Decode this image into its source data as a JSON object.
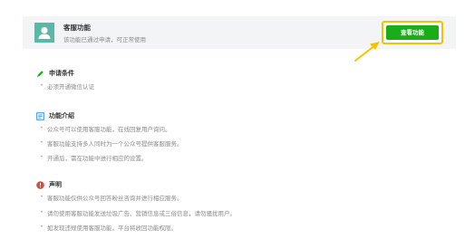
{
  "feature": {
    "name": "客服功能",
    "status": "该功能已通过申请，可正常使用",
    "view_button_label": "查看功能"
  },
  "colors": {
    "accent_green": "#1aad19",
    "highlight_yellow": "#f0c400",
    "avatar_teal": "#5cb7a5",
    "notice_red": "#e64340",
    "intro_blue": "#3a8ee6"
  },
  "sections": {
    "requirements": {
      "title": "申请条件",
      "icon": "pencil-icon",
      "items": [
        "必须开通微信认证"
      ]
    },
    "intro": {
      "title": "功能介绍",
      "icon": "document-icon",
      "items": [
        "公众号可以使用客服功能，在线回复用户询问。",
        "客服功能支持多人同时为一个公众号提供客服服务。",
        "开通后，需在功能中进行相应的设置。"
      ]
    },
    "statement": {
      "title": "声明",
      "icon": "warning-icon",
      "items": [
        "客服功能仅供公众号回答粉丝咨询并进行相应服务。",
        "请勿使用客服功能发送垃圾广告、营销信息或三俗信息，请勿骚扰用户。",
        "如发现违规使用客服功能，平台将收回功能权限。"
      ]
    }
  }
}
